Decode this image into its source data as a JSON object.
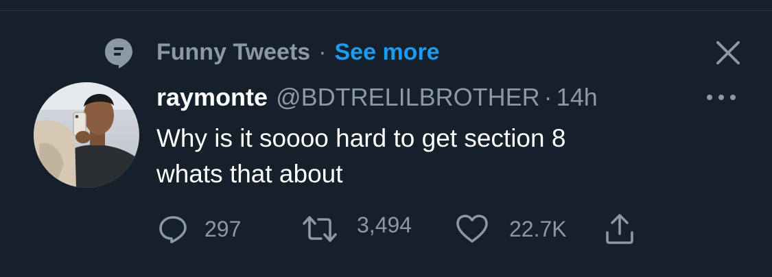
{
  "context": {
    "icon": "topic-icon",
    "topic": "Funny Tweets",
    "separator": "·",
    "see_more": "See more",
    "close_icon": "close-icon"
  },
  "tweet": {
    "avatar_icon": "profile-photo",
    "display_name": "raymonte",
    "handle": "@BDTRELILBROTHER",
    "separator": "·",
    "time": "14h",
    "more_icon": "more-options-icon",
    "text_lines": [
      "Why is it soooo hard to get section 8",
      "whats that about"
    ]
  },
  "actions": {
    "reply": {
      "icon": "reply-icon",
      "count": "297"
    },
    "retweet": {
      "icon": "retweet-icon",
      "count": "3,494"
    },
    "like": {
      "icon": "like-icon",
      "count": "22.7K"
    },
    "share": {
      "icon": "share-icon"
    }
  },
  "colors": {
    "background": "#15202b",
    "primary_text": "#ffffff",
    "secondary_text": "#8b98a5",
    "link": "#1d9bf0",
    "divider": "#2f3336"
  }
}
